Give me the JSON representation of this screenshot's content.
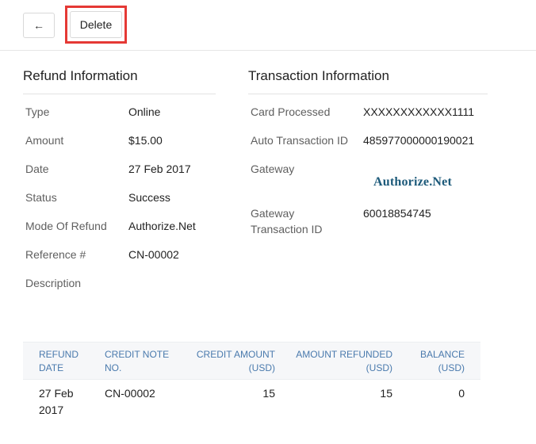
{
  "toolbar": {
    "back_label": "←",
    "delete_label": "Delete"
  },
  "refund_info": {
    "title": "Refund Information",
    "fields": [
      {
        "label": "Type",
        "value": "Online"
      },
      {
        "label": "Amount",
        "value": "$15.00"
      },
      {
        "label": "Date",
        "value": "27 Feb 2017"
      },
      {
        "label": "Status",
        "value": "Success"
      },
      {
        "label": "Mode Of Refund",
        "value": "Authorize.Net"
      },
      {
        "label": "Reference #",
        "value": "CN-00002"
      },
      {
        "label": "Description",
        "value": ""
      }
    ]
  },
  "transaction_info": {
    "title": "Transaction Information",
    "card_processed_label": "Card Processed",
    "card_processed_value": "XXXXXXXXXXXX1111",
    "auto_txn_label": "Auto Transaction ID",
    "auto_txn_value": "485977000000190021",
    "gateway_label": "Gateway",
    "gateway_logo_text": "Authorize.Net",
    "gateway_txn_label_line1": "Gateway",
    "gateway_txn_label_line2": "Transaction ID",
    "gateway_txn_value": "60018854745"
  },
  "table": {
    "headers": {
      "refund_date_1": "REFUND",
      "refund_date_2": "DATE",
      "credit_note_1": "CREDIT NOTE",
      "credit_note_2": "NO.",
      "credit_amount_1": "CREDIT AMOUNT",
      "credit_amount_2": "(USD)",
      "amount_refunded_1": "AMOUNT REFUNDED",
      "amount_refunded_2": "(USD)",
      "balance_1": "BALANCE",
      "balance_2": "(USD)"
    },
    "rows": [
      {
        "date_1": "27 Feb",
        "date_2": "2017",
        "credit_note": "CN-00002",
        "credit_amount": "15",
        "amount_refunded": "15",
        "balance": "0"
      }
    ]
  }
}
